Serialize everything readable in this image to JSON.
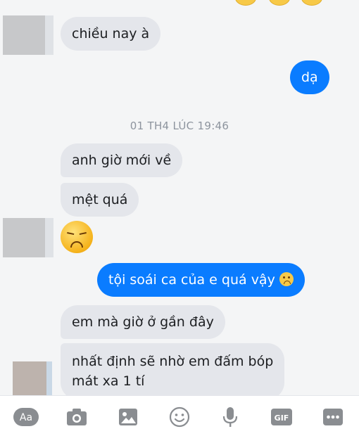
{
  "messages": [
    {
      "id": "m1",
      "side": "incoming",
      "text": "chiều nay à"
    },
    {
      "id": "m2",
      "side": "outgoing",
      "text": "dạ"
    },
    {
      "id": "m3",
      "side": "incoming",
      "text": "anh giờ mới về"
    },
    {
      "id": "m4",
      "side": "incoming",
      "text": "mệt quá"
    },
    {
      "id": "m5",
      "side": "incoming",
      "emoji": "disappointed-face"
    },
    {
      "id": "m6",
      "side": "outgoing",
      "text": "tội soái ca của e quá vậy",
      "emoji": "sad-face"
    },
    {
      "id": "m7",
      "side": "incoming",
      "text": "em mà giờ ở gần đây"
    },
    {
      "id": "m8",
      "side": "incoming",
      "lines": [
        "nhất định sẽ nhờ em đấm bóp",
        "mát xa 1 tí"
      ]
    }
  ],
  "timestamp": "01 TH4 LÚC 19:46",
  "composer": {
    "text_button_label": "Aa",
    "gif_label": "GIF",
    "tools": [
      "text-format-icon",
      "camera-icon",
      "gallery-icon",
      "emoji-icon",
      "microphone-icon",
      "gif-icon",
      "more-icon"
    ]
  },
  "colors": {
    "outgoing_bubble": "#0a7cff",
    "incoming_bubble": "#e4e6eb",
    "icon_gray": "#8a8d91"
  }
}
